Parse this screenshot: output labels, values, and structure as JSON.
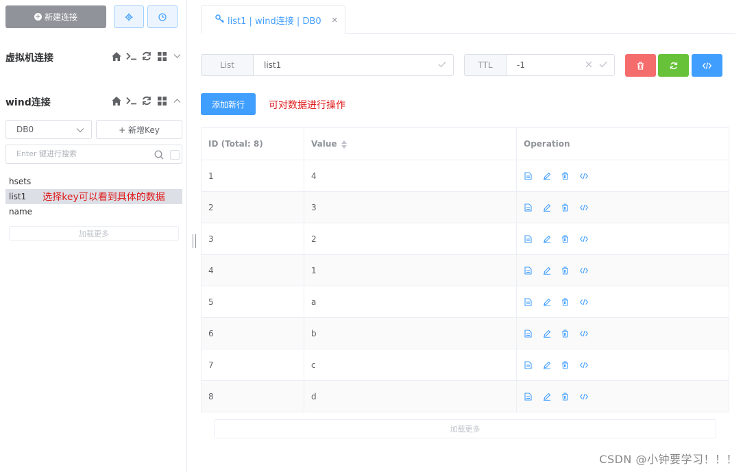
{
  "sidebar": {
    "new_connection_label": "新建连接",
    "connections": [
      {
        "name": "虚拟机连接",
        "expanded": false
      },
      {
        "name": "wind连接",
        "expanded": true
      }
    ],
    "db_select": {
      "value": "DB0"
    },
    "new_key_label": "+ 新增Key",
    "search": {
      "placeholder": "Enter 键进行搜索"
    },
    "keys": [
      "hsets",
      "list1",
      "name"
    ],
    "selected_key": "list1",
    "key_annotation": "选择key可以看到具体的数据",
    "load_more_label": "加载更多"
  },
  "tab": {
    "label": "list1 | wind连接 | DB0",
    "icon": "key-icon"
  },
  "key_detail": {
    "type_label": "List",
    "key_name": "list1",
    "ttl_label": "TTL",
    "ttl_value": "-1",
    "colors": {
      "delete": "#f56c6c",
      "refresh": "#67c23a",
      "dump": "#409eff"
    }
  },
  "add_row_label": "添加新行",
  "add_row_annotation": "可对数据进行操作",
  "table": {
    "headers": {
      "id": "ID (Total: 8)",
      "value": "Value",
      "operation": "Operation"
    },
    "rows": [
      {
        "id": "1",
        "value": "4"
      },
      {
        "id": "2",
        "value": "3"
      },
      {
        "id": "3",
        "value": "2"
      },
      {
        "id": "4",
        "value": "1"
      },
      {
        "id": "5",
        "value": "a"
      },
      {
        "id": "6",
        "value": "b"
      },
      {
        "id": "7",
        "value": "c"
      },
      {
        "id": "8",
        "value": "d"
      }
    ],
    "load_more_label": "加载更多"
  },
  "watermark": "CSDN @小钟要学习！！！",
  "accent_color": "#409eff"
}
